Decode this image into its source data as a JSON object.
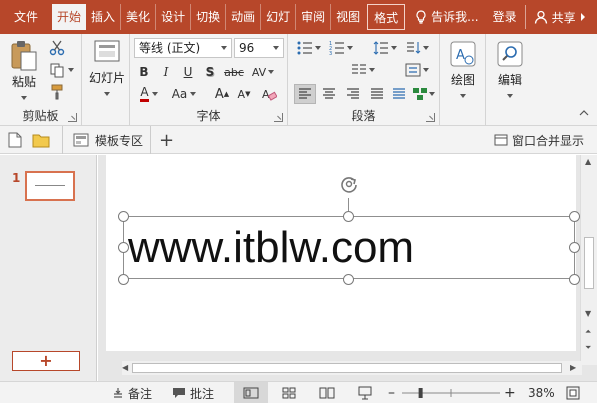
{
  "tabs": [
    {
      "label": "文件",
      "active": false
    },
    {
      "label": "开始",
      "active": true
    },
    {
      "label": "插入",
      "active": false
    },
    {
      "label": "美化",
      "active": false
    },
    {
      "label": "设计",
      "active": false
    },
    {
      "label": "切换",
      "active": false
    },
    {
      "label": "动画",
      "active": false
    },
    {
      "label": "幻灯",
      "active": false
    },
    {
      "label": "审阅",
      "active": false
    },
    {
      "label": "视图",
      "active": false
    },
    {
      "label": "格式",
      "active": false
    }
  ],
  "tell_me": "告诉我...",
  "login": "登录",
  "share": "共享",
  "ribbon": {
    "clipboard": {
      "label": "剪贴板",
      "paste": "粘贴"
    },
    "slides": {
      "label": "幻灯片",
      "new_slide": "幻灯片"
    },
    "font": {
      "label": "字体",
      "font_name": "等线 (正文)",
      "font_size": "96",
      "bold": "B",
      "italic": "I",
      "underline": "U",
      "shadow": "S",
      "strike": "abc",
      "spacing": "AV",
      "font_color": "A",
      "case": "Aa",
      "grow": "A",
      "shrink": "A"
    },
    "paragraph": {
      "label": "段落"
    },
    "drawing": {
      "label": "绘图"
    },
    "editing": {
      "label": "编辑"
    }
  },
  "quick": {
    "template": "模板专区",
    "window_merge": "窗口合并显示"
  },
  "thumbnails": {
    "slide_number": "1",
    "add": "+"
  },
  "slide": {
    "text": "www.itblw.com"
  },
  "status": {
    "notes": "备注",
    "comments": "批注",
    "zoom": "38%",
    "zoom_fraction": 0.38
  },
  "colors": {
    "accent": "#b7472a",
    "ribbon_bg": "#f3f3f3"
  }
}
